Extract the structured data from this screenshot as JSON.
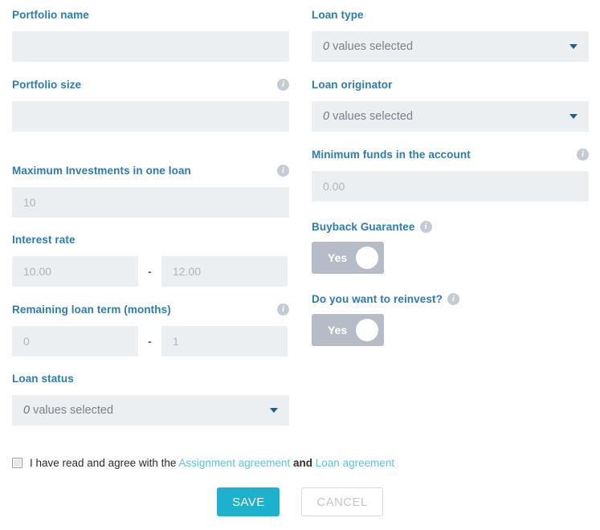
{
  "form": {
    "left_column": [
      {
        "id": "portfolio-name",
        "label": "Portfolio name",
        "type": "text",
        "value": "",
        "placeholder": "",
        "has_info": false
      },
      {
        "id": "portfolio-size",
        "label": "Portfolio size",
        "type": "text",
        "value": "",
        "placeholder": "",
        "has_info": true,
        "info_icon": "info-icon"
      },
      {
        "id": "maximum-investments-in-one-loan",
        "label": "Maximum Investments in one loan",
        "type": "text",
        "value": "",
        "placeholder": "10",
        "has_info": true,
        "info_icon": "info-icon"
      },
      {
        "id": "interest-rate",
        "label": "Interest rate",
        "type": "range",
        "separator": "-",
        "from_placeholder": "10.00",
        "to_placeholder": "12.00",
        "from_value": "",
        "to_value": "",
        "has_info": false
      },
      {
        "id": "remaining-loan-term-months",
        "label": "Remaining loan term (months)",
        "type": "range",
        "separator": "-",
        "from_placeholder": "0",
        "to_placeholder": "1",
        "from_value": "",
        "to_value": "",
        "has_info": true,
        "info_icon": "info-icon"
      },
      {
        "id": "loan-status",
        "label": "Loan status",
        "type": "multiselect",
        "selected_count": "0",
        "selected_suffix": "values selected",
        "caret_icon": "chevron-down-icon",
        "has_info": false
      }
    ],
    "right_column": [
      {
        "id": "loan-type",
        "label": "Loan type",
        "type": "multiselect",
        "selected_count": "0",
        "selected_suffix": "values selected",
        "caret_icon": "chevron-down-icon",
        "has_info": false
      },
      {
        "id": "loan-originator",
        "label": "Loan originator",
        "type": "multiselect",
        "selected_count": "0",
        "selected_suffix": "values selected",
        "caret_icon": "chevron-down-icon",
        "has_info": false
      },
      {
        "id": "minimum-funds-in-the-account",
        "label": "Minimum funds in the account",
        "type": "text",
        "value": "",
        "placeholder": "0.00",
        "has_info": true,
        "info_icon": "info-icon"
      },
      {
        "id": "buyback-guarantee",
        "label": "Buyback Guarantee",
        "type": "toggle",
        "toggle_label": "Yes",
        "has_info": true,
        "info_icon": "info-icon"
      },
      {
        "id": "do-you-want-to-reinvest",
        "label": "Do you want to reinvest?",
        "type": "toggle",
        "toggle_label": "Yes",
        "has_info": true,
        "info_icon": "info-icon"
      }
    ]
  },
  "agreement": {
    "checkbox_checked": false,
    "text_before": "I have read and agree with the",
    "link_assignment": "Assignment agreement",
    "text_between": "and",
    "link_loan": "Loan agreement"
  },
  "actions": {
    "save_label": "SAVE",
    "cancel_label": "CANCEL"
  },
  "info_glyph": "i",
  "colors": {
    "label_blue": "#2b7cb0",
    "input_bg": "#eceff2",
    "placeholder": "#aeb4bc",
    "toggle_bg": "#b5bcc8",
    "save_bg": "#1cb2ce",
    "link": "#5bc5dc",
    "caret": "#1d5f8a",
    "info_icon_bg": "#c3cbd4",
    "cancel_text": "#c3c8cd",
    "cancel_border": "#d6dade"
  }
}
